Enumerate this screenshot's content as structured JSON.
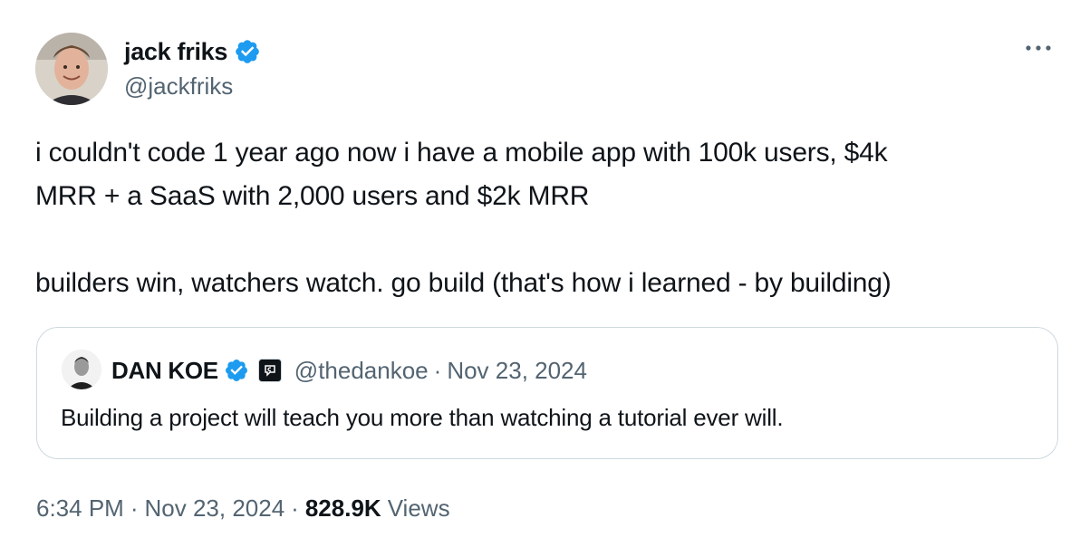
{
  "author": {
    "name": "jack friks",
    "handle": "@jackfriks",
    "verified": true
  },
  "tweet": {
    "line1": "i couldn't code 1 year ago now i have a mobile app with 100k users, $4k",
    "line2": "MRR + a SaaS with 2,000 users and $2k MRR",
    "line3": "builders win, watchers watch. go build (that's how i learned - by building)"
  },
  "quote": {
    "name": "DAN KOE",
    "handle": "@thedankoe",
    "separator": "·",
    "date": "Nov 23, 2024",
    "text": "Building a project will teach you more than watching a tutorial ever will.",
    "verified": true,
    "affiliate_icon": "affiliate-badge-icon"
  },
  "meta": {
    "time": "6:34 PM",
    "separator": "·",
    "date": "Nov 23, 2024",
    "views_count": "828.9K",
    "views_label": "Views"
  },
  "colors": {
    "text": "#0f1419",
    "secondary": "#536471",
    "verified_blue": "#1d9bf0",
    "border": "#cfd9de"
  },
  "icons": {
    "more": "more-options-icon",
    "verified": "verified-badge-icon"
  }
}
